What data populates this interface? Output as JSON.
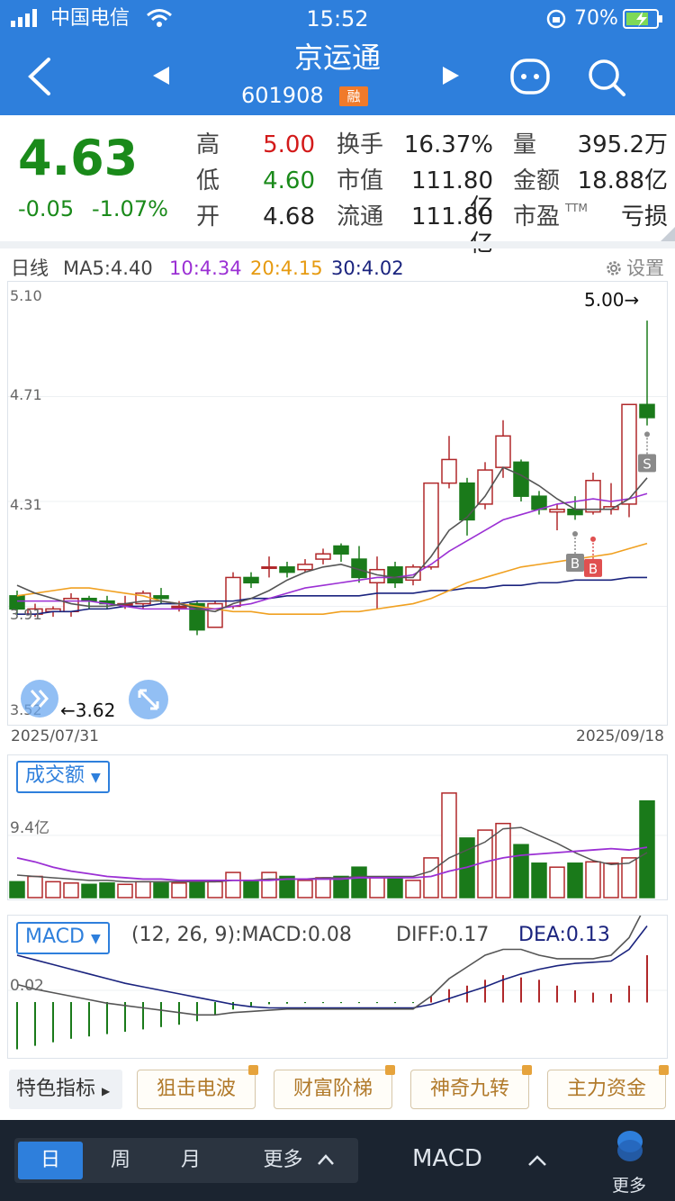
{
  "status": {
    "carrier": "中国电信",
    "time": "15:52",
    "battery": "70%"
  },
  "header": {
    "title": "京运通",
    "code": "601908",
    "tag": "融"
  },
  "quote": {
    "price": "4.63",
    "change": "-0.05",
    "change_pct": "-1.07%",
    "labels": {
      "high": "高",
      "low": "低",
      "open": "开",
      "turnover": "换手",
      "mcap": "市值",
      "float": "流通",
      "volume": "量",
      "amount": "金额",
      "pe": "市盈",
      "pe_sup": "TTM"
    },
    "values": {
      "high": "5.00",
      "low": "4.60",
      "open": "4.68",
      "turnover": "16.37%",
      "mcap": "111.80亿",
      "float": "111.80亿",
      "volume": "395.2万",
      "amount": "18.88亿",
      "pe": "亏损"
    }
  },
  "ma": {
    "period": "日线",
    "ma5": "MA5:4.40",
    "ma10": "10:4.34",
    "ma20": "20:4.15",
    "ma30": "30:4.02",
    "settings": "设置"
  },
  "colors": {
    "up": "#b0282a",
    "down": "#1a7a1a",
    "ma5": "#555555",
    "ma10": "#9b30d4",
    "ma20": "#f0a020",
    "ma30": "#1a237e",
    "accent": "#2e7fdc"
  },
  "kline": {
    "axis": [
      "5.10",
      "4.71",
      "4.31",
      "3.91",
      "3.52"
    ],
    "high_label": "5.00→",
    "low_label": "←3.62",
    "start_date": "2025/07/31",
    "end_date": "2025/09/18",
    "marks": {
      "s": "S",
      "b1": "B",
      "b2": "B"
    }
  },
  "volume": {
    "selector": "成交额",
    "axis": "9.4亿"
  },
  "macd": {
    "selector": "MACD",
    "params": "(12, 26, 9):MACD:0.08",
    "diff": "DIFF:0.17",
    "dea": "DEA:0.13",
    "axis": "0.02"
  },
  "indicators": {
    "feature": "特色指标",
    "items": [
      "狙击电波",
      "财富阶梯",
      "神奇九转",
      "主力资金"
    ]
  },
  "footer": {
    "day": "日",
    "week": "周",
    "month": "月",
    "more_period": "更多",
    "indicator": "MACD",
    "more": "更多"
  },
  "chart_data": {
    "type": "candlestick",
    "title": "",
    "ylim": [
      3.52,
      5.1
    ],
    "dates": [
      "2025/07/31",
      "2025/09/18"
    ],
    "candles": [
      {
        "o": 3.95,
        "c": 3.9,
        "h": 3.97,
        "l": 3.88
      },
      {
        "o": 3.88,
        "c": 3.9,
        "h": 3.92,
        "l": 3.87
      },
      {
        "o": 3.89,
        "c": 3.9,
        "h": 3.91,
        "l": 3.87
      },
      {
        "o": 3.89,
        "c": 3.94,
        "h": 3.96,
        "l": 3.87
      },
      {
        "o": 3.94,
        "c": 3.93,
        "h": 3.95,
        "l": 3.9
      },
      {
        "o": 3.93,
        "c": 3.92,
        "h": 3.95,
        "l": 3.9
      },
      {
        "o": 3.92,
        "c": 3.92,
        "h": 3.95,
        "l": 3.9
      },
      {
        "o": 3.92,
        "c": 3.96,
        "h": 3.97,
        "l": 3.9
      },
      {
        "o": 3.95,
        "c": 3.94,
        "h": 3.98,
        "l": 3.92
      },
      {
        "o": 3.91,
        "c": 3.91,
        "h": 3.93,
        "l": 3.89
      },
      {
        "o": 3.92,
        "c": 3.82,
        "h": 3.93,
        "l": 3.8
      },
      {
        "o": 3.83,
        "c": 3.92,
        "h": 3.93,
        "l": 3.83
      },
      {
        "o": 3.91,
        "c": 4.02,
        "h": 4.04,
        "l": 3.9
      },
      {
        "o": 4.02,
        "c": 4.0,
        "h": 4.04,
        "l": 3.98
      },
      {
        "o": 4.06,
        "c": 4.06,
        "h": 4.1,
        "l": 4.02
      },
      {
        "o": 4.06,
        "c": 4.04,
        "h": 4.08,
        "l": 4.02
      },
      {
        "o": 4.05,
        "c": 4.07,
        "h": 4.09,
        "l": 4.04
      },
      {
        "o": 4.09,
        "c": 4.11,
        "h": 4.13,
        "l": 4.07
      },
      {
        "o": 4.14,
        "c": 4.11,
        "h": 4.15,
        "l": 4.08
      },
      {
        "o": 4.09,
        "c": 4.02,
        "h": 4.14,
        "l": 4.0
      },
      {
        "o": 4.0,
        "c": 4.05,
        "h": 4.1,
        "l": 3.9
      },
      {
        "o": 4.06,
        "c": 4.0,
        "h": 4.08,
        "l": 3.98
      },
      {
        "o": 4.01,
        "c": 4.06,
        "h": 4.07,
        "l": 3.99
      },
      {
        "o": 4.06,
        "c": 4.38,
        "h": 4.38,
        "l": 4.05
      },
      {
        "o": 4.38,
        "c": 4.47,
        "h": 4.56,
        "l": 4.36
      },
      {
        "o": 4.38,
        "c": 4.24,
        "h": 4.4,
        "l": 4.18
      },
      {
        "o": 4.3,
        "c": 4.43,
        "h": 4.46,
        "l": 4.28
      },
      {
        "o": 4.44,
        "c": 4.56,
        "h": 4.62,
        "l": 4.4
      },
      {
        "o": 4.46,
        "c": 4.33,
        "h": 4.47,
        "l": 4.31
      },
      {
        "o": 4.33,
        "c": 4.28,
        "h": 4.35,
        "l": 4.26
      },
      {
        "o": 4.27,
        "c": 4.28,
        "h": 4.3,
        "l": 4.2
      },
      {
        "o": 4.28,
        "c": 4.26,
        "h": 4.33,
        "l": 4.24
      },
      {
        "o": 4.27,
        "c": 4.39,
        "h": 4.42,
        "l": 4.26
      },
      {
        "o": 4.28,
        "c": 4.29,
        "h": 4.38,
        "l": 4.26
      },
      {
        "o": 4.3,
        "c": 4.68,
        "h": 4.68,
        "l": 4.25
      },
      {
        "o": 4.68,
        "c": 4.63,
        "h": 5.0,
        "l": 4.6
      }
    ],
    "ma5": [
      3.99,
      3.96,
      3.94,
      3.92,
      3.91,
      3.91,
      3.92,
      3.93,
      3.93,
      3.92,
      3.9,
      3.89,
      3.92,
      3.94,
      3.97,
      4.01,
      4.04,
      4.06,
      4.07,
      4.05,
      4.03,
      4.02,
      4.02,
      4.1,
      4.2,
      4.25,
      4.33,
      4.44,
      4.41,
      4.37,
      4.32,
      4.28,
      4.28,
      4.28,
      4.32,
      4.4
    ],
    "ma10": [
      3.93,
      3.93,
      3.93,
      3.93,
      3.93,
      3.92,
      3.91,
      3.9,
      3.9,
      3.9,
      3.9,
      3.9,
      3.91,
      3.92,
      3.94,
      3.96,
      3.98,
      3.99,
      4.0,
      4.01,
      4.02,
      4.02,
      4.03,
      4.07,
      4.12,
      4.16,
      4.2,
      4.24,
      4.26,
      4.28,
      4.3,
      4.31,
      4.32,
      4.31,
      4.32,
      4.34
    ],
    "ma20": [
      3.95,
      3.96,
      3.97,
      3.98,
      3.98,
      3.97,
      3.96,
      3.95,
      3.93,
      3.92,
      3.91,
      3.9,
      3.89,
      3.89,
      3.88,
      3.88,
      3.88,
      3.88,
      3.89,
      3.89,
      3.9,
      3.91,
      3.92,
      3.94,
      3.97,
      4.0,
      4.02,
      4.04,
      4.06,
      4.07,
      4.08,
      4.09,
      4.1,
      4.11,
      4.13,
      4.15
    ],
    "ma30": [
      3.88,
      3.88,
      3.89,
      3.89,
      3.9,
      3.9,
      3.91,
      3.91,
      3.92,
      3.92,
      3.93,
      3.93,
      3.93,
      3.94,
      3.94,
      3.95,
      3.95,
      3.95,
      3.95,
      3.95,
      3.96,
      3.96,
      3.96,
      3.97,
      3.97,
      3.98,
      3.98,
      3.99,
      3.99,
      4.0,
      4.0,
      4.01,
      4.01,
      4.01,
      4.02,
      4.02
    ],
    "volume": [
      1.2,
      1.6,
      1.2,
      1.1,
      1.0,
      1.1,
      1.0,
      1.2,
      1.1,
      1.1,
      1.2,
      1.2,
      1.9,
      1.3,
      1.9,
      1.6,
      1.3,
      1.5,
      1.6,
      2.3,
      1.5,
      1.5,
      1.3,
      3.0,
      7.9,
      4.5,
      5.1,
      5.6,
      4.0,
      2.6,
      2.3,
      2.6,
      2.7,
      2.6,
      3.0,
      7.3
    ],
    "volume_ma1": [
      1.7,
      1.6,
      1.5,
      1.4,
      1.3,
      1.3,
      1.2,
      1.2,
      1.2,
      1.2,
      1.2,
      1.2,
      1.3,
      1.3,
      1.4,
      1.4,
      1.4,
      1.5,
      1.5,
      1.6,
      1.6,
      1.6,
      1.6,
      2.0,
      3.0,
      3.6,
      4.2,
      5.2,
      5.3,
      4.7,
      4.1,
      3.4,
      2.8,
      2.5,
      2.6,
      3.4
    ],
    "volume_ma2": [
      3.0,
      2.7,
      2.3,
      2.0,
      1.8,
      1.6,
      1.5,
      1.4,
      1.4,
      1.3,
      1.3,
      1.3,
      1.3,
      1.3,
      1.3,
      1.4,
      1.4,
      1.4,
      1.4,
      1.5,
      1.5,
      1.5,
      1.5,
      1.6,
      2.0,
      2.3,
      2.7,
      3.0,
      3.2,
      3.3,
      3.4,
      3.5,
      3.6,
      3.7,
      3.6,
      3.8
    ],
    "macd_hist": [
      -0.08,
      -0.074,
      -0.068,
      -0.062,
      -0.058,
      -0.054,
      -0.05,
      -0.046,
      -0.042,
      -0.038,
      -0.032,
      -0.022,
      -0.012,
      -0.006,
      -0.003,
      -0.002,
      -0.001,
      -0.001,
      -0.001,
      -0.001,
      -0.001,
      -0.001,
      -0.001,
      0.01,
      0.022,
      0.028,
      0.038,
      0.046,
      0.042,
      0.038,
      0.028,
      0.02,
      0.016,
      0.014,
      0.028,
      0.08
    ],
    "dif": [
      0.03,
      0.022,
      0.016,
      0.01,
      0.004,
      -0.002,
      -0.006,
      -0.01,
      -0.014,
      -0.018,
      -0.022,
      -0.022,
      -0.018,
      -0.016,
      -0.014,
      -0.012,
      -0.012,
      -0.012,
      -0.012,
      -0.012,
      -0.012,
      -0.012,
      -0.012,
      0.01,
      0.04,
      0.06,
      0.08,
      0.09,
      0.09,
      0.08,
      0.074,
      0.074,
      0.074,
      0.08,
      0.11,
      0.17
    ],
    "dea": [
      0.08,
      0.072,
      0.064,
      0.056,
      0.048,
      0.04,
      0.032,
      0.026,
      0.02,
      0.014,
      0.008,
      0.002,
      -0.004,
      -0.008,
      -0.01,
      -0.01,
      -0.01,
      -0.01,
      -0.01,
      -0.01,
      -0.01,
      -0.01,
      -0.01,
      -0.004,
      0.006,
      0.016,
      0.026,
      0.038,
      0.048,
      0.056,
      0.062,
      0.066,
      0.068,
      0.07,
      0.09,
      0.13
    ]
  }
}
